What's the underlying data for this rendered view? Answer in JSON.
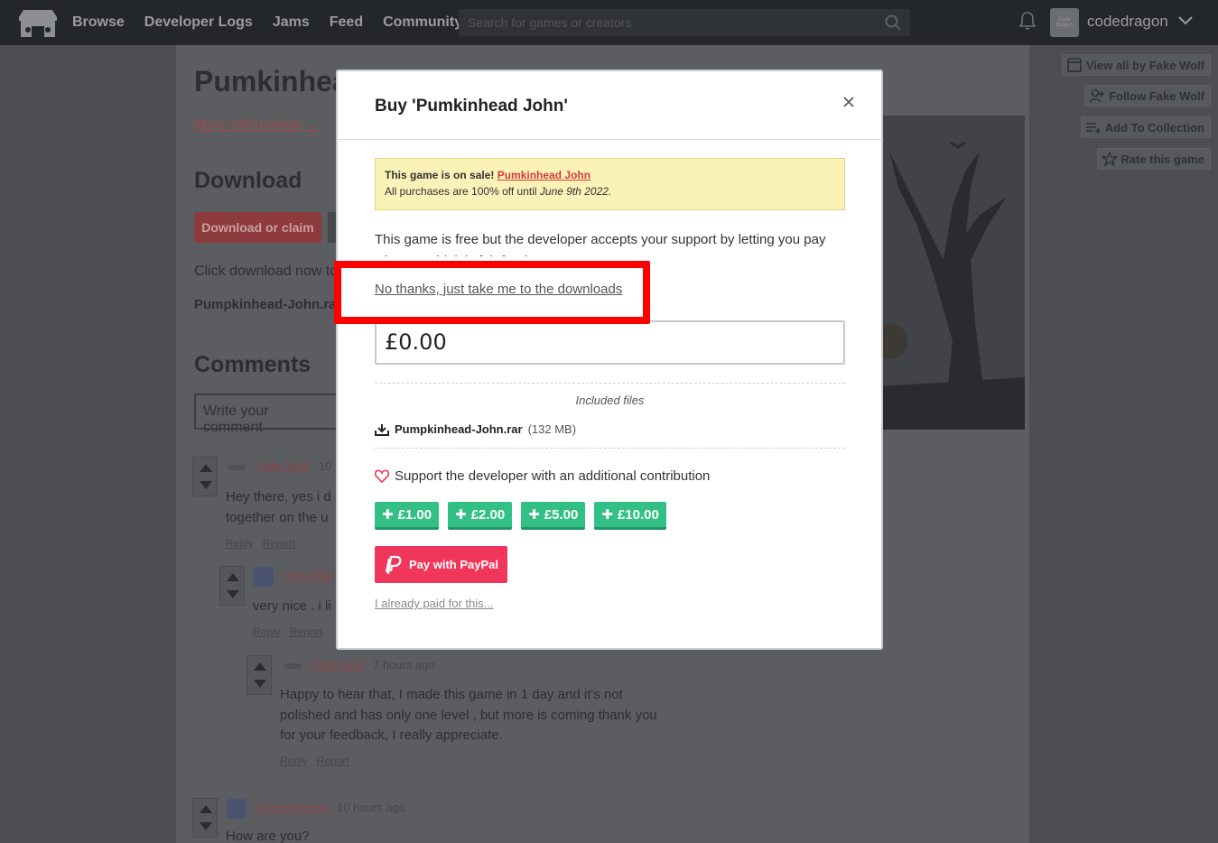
{
  "nav": {
    "links": [
      "Browse",
      "Developer Logs",
      "Jams",
      "Feed",
      "Community"
    ],
    "search_placeholder": "Search for games or creators",
    "username": "codedragon",
    "avatar_text": "Code Dragon"
  },
  "page": {
    "title": "Pumkinhea",
    "more_info": "More information",
    "download_heading": "Download",
    "download_button": "Download or claim",
    "click_download": "Click download now to",
    "file_name": "Pumpkinhead-John.rar",
    "comments_heading": "Comments",
    "comment_placeholder": "Write your comment"
  },
  "sidebar_buttons": [
    "View all by Fake Wolf",
    "Follow Fake Wolf",
    "Add To Collection",
    "Rate this game"
  ],
  "comments": [
    {
      "author": "Fake Wolf",
      "time": "10",
      "body": [
        "Hey there, yes i d",
        "together on the u"
      ],
      "reply": "Reply",
      "report": "Report"
    },
    {
      "author": "OmioRah",
      "time": "",
      "body": [
        "very nice . i li"
      ],
      "reply": "Reply",
      "report": "Report"
    },
    {
      "author": "Fake Wolf",
      "time": "7 hours ago",
      "body": [
        "Happy to hear that, I made this game in 1 day and it's not",
        "polished and has only one level , but more is coming thank you",
        "for your feedback, I really appreciate."
      ],
      "reply": "Reply",
      "report": "Report"
    },
    {
      "author": "OmioRahman",
      "time": "10 hours ago",
      "body": [
        "How are you?"
      ]
    }
  ],
  "modal": {
    "title": "Buy 'Pumkinhead John'",
    "sale_prefix": "This game is on sale!",
    "sale_link": "Pumkinhead John",
    "sale_text": "All purchases are 100% off until",
    "sale_date": "June 9th 2022.",
    "description": "This game is free but the developer accepts your support by letting you pay what you think is fair for the game.",
    "no_thanks": "No thanks, just take me to the downloads",
    "price": "£0.00",
    "included_files": "Included files",
    "file_name": "Pumpkinhead-John.rar",
    "file_size": "(132 MB)",
    "support_text": "Support the developer with an additional contribution",
    "tips": [
      "£1.00",
      "£2.00",
      "£5.00",
      "£10.00"
    ],
    "paypal": "Pay with PayPal",
    "already_paid": "I already paid for this..."
  }
}
